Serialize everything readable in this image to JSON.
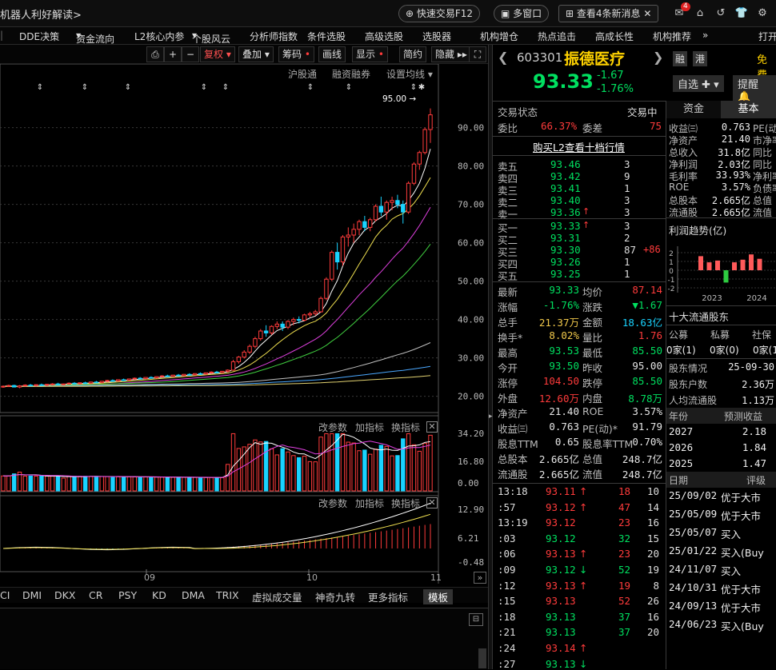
{
  "topbar": {
    "title": "机器人利好解读>",
    "quick_trade": "快速交易F12",
    "multi_window": "多窗口",
    "messages": "查看4条新消息",
    "mail_badge": "4"
  },
  "menu": [
    "DDE决策",
    "资金流向",
    "L2核心内参",
    "个股风云",
    "分析师指数",
    "条件选股",
    "高级选股",
    "选股器",
    "机构增仓",
    "热点追击",
    "高成长性",
    "机构推荐",
    "打开"
  ],
  "toolbar": {
    "fuquan": "复权",
    "diejia": "叠加",
    "chouma": "筹码",
    "huaxian": "画线",
    "xianshi": "显示",
    "jianyue": "简约",
    "yincang": "隐藏"
  },
  "chart_links": {
    "hgt": "沪股通",
    "rzrq": "融资融券",
    "settings": "设置均线"
  },
  "chart_data": {
    "type": "candlestick",
    "price_axis": [
      "90.00",
      "80.00",
      "70.00",
      "60.00",
      "50.00",
      "40.00",
      "30.00",
      "20.00"
    ],
    "max_label": "95.00",
    "ylim": [
      17,
      102
    ],
    "months": [
      "09",
      "10",
      "11"
    ],
    "candles": [
      [
        22.5,
        22.8,
        22.2,
        22.6
      ],
      [
        22.6,
        23.0,
        22.4,
        22.8
      ],
      [
        22.8,
        23.0,
        22.3,
        22.4
      ],
      [
        22.4,
        22.9,
        22.1,
        22.7
      ],
      [
        22.7,
        23.1,
        22.5,
        22.9
      ],
      [
        22.9,
        23.2,
        22.6,
        22.8
      ],
      [
        22.8,
        23.1,
        22.5,
        23.0
      ],
      [
        23.0,
        23.3,
        22.7,
        22.9
      ],
      [
        22.9,
        23.2,
        22.6,
        23.1
      ],
      [
        23.1,
        23.4,
        22.8,
        23.2
      ],
      [
        23.2,
        23.5,
        22.9,
        23.0
      ],
      [
        23.0,
        23.3,
        22.8,
        23.2
      ],
      [
        23.2,
        23.6,
        23.0,
        23.4
      ],
      [
        23.4,
        23.7,
        23.1,
        23.3
      ],
      [
        23.3,
        23.6,
        23.0,
        23.5
      ],
      [
        23.5,
        23.8,
        23.2,
        23.4
      ],
      [
        23.4,
        23.8,
        23.2,
        23.7
      ],
      [
        23.7,
        24.0,
        23.4,
        23.6
      ],
      [
        23.6,
        24.0,
        23.4,
        23.9
      ],
      [
        23.9,
        24.3,
        23.7,
        24.1
      ],
      [
        24.1,
        24.4,
        23.8,
        24.0
      ],
      [
        24.0,
        24.4,
        23.8,
        24.3
      ],
      [
        24.3,
        24.6,
        24.0,
        24.2
      ],
      [
        24.2,
        24.6,
        24.0,
        24.5
      ],
      [
        24.5,
        24.9,
        24.3,
        24.7
      ],
      [
        24.7,
        25.0,
        24.4,
        24.6
      ],
      [
        24.6,
        25.0,
        24.4,
        24.9
      ],
      [
        24.9,
        25.2,
        24.6,
        24.8
      ],
      [
        24.8,
        25.2,
        24.6,
        25.1
      ],
      [
        25.1,
        25.5,
        24.9,
        25.3
      ],
      [
        25.3,
        25.6,
        25.0,
        25.2
      ],
      [
        25.2,
        25.6,
        25.0,
        25.5
      ],
      [
        25.5,
        25.8,
        25.2,
        25.4
      ],
      [
        25.4,
        25.8,
        25.2,
        25.7
      ],
      [
        25.7,
        26.0,
        25.4,
        25.6
      ],
      [
        25.6,
        26.0,
        25.4,
        25.9
      ],
      [
        25.9,
        26.2,
        25.6,
        25.8
      ],
      [
        25.8,
        26.2,
        25.6,
        26.1
      ],
      [
        26.1,
        26.5,
        25.9,
        26.3
      ],
      [
        26.3,
        26.6,
        26.0,
        26.2
      ],
      [
        26.2,
        26.6,
        26.0,
        26.5
      ],
      [
        26.5,
        27.0,
        26.2,
        26.8
      ],
      [
        26.8,
        29.5,
        26.6,
        29.0
      ],
      [
        29.0,
        30.5,
        28.5,
        30.2
      ],
      [
        30.2,
        32.0,
        29.8,
        31.5
      ],
      [
        31.5,
        33.5,
        31.0,
        33.0
      ],
      [
        33.0,
        35.5,
        32.5,
        35.0
      ],
      [
        35.0,
        37.5,
        34.5,
        37.0
      ],
      [
        37.0,
        38.5,
        35.5,
        36.5
      ],
      [
        36.5,
        38.5,
        36.0,
        38.2
      ],
      [
        38.2,
        39.5,
        37.5,
        38.8
      ],
      [
        38.8,
        39.5,
        37.0,
        38.0
      ],
      [
        38.0,
        39.8,
        37.5,
        39.5
      ],
      [
        39.5,
        40.5,
        38.5,
        40.0
      ],
      [
        40.0,
        40.8,
        39.0,
        39.8
      ],
      [
        39.8,
        41.5,
        39.5,
        41.2
      ],
      [
        41.2,
        42.0,
        40.5,
        41.5
      ],
      [
        41.5,
        42.5,
        41.0,
        42.0
      ],
      [
        42.0,
        46.0,
        41.8,
        45.5
      ],
      [
        45.5,
        51.0,
        45.0,
        50.5
      ],
      [
        50.5,
        58.0,
        50.0,
        57.5
      ],
      [
        57.5,
        60.0,
        53.0,
        55.0
      ],
      [
        55.0,
        62.0,
        54.0,
        61.5
      ],
      [
        61.5,
        64.0,
        59.0,
        62.0
      ],
      [
        62.0,
        65.0,
        60.0,
        63.5
      ],
      [
        63.5,
        66.0,
        62.0,
        65.5
      ],
      [
        65.5,
        67.0,
        63.0,
        64.0
      ],
      [
        64.0,
        66.5,
        63.0,
        66.0
      ],
      [
        66.0,
        70.0,
        65.5,
        69.5
      ],
      [
        69.5,
        72.0,
        67.0,
        68.0
      ],
      [
        68.0,
        71.0,
        66.0,
        70.5
      ],
      [
        70.5,
        72.0,
        68.5,
        71.0
      ],
      [
        71.0,
        72.5,
        69.0,
        70.0
      ],
      [
        70.0,
        71.0,
        65.0,
        68.0
      ],
      [
        68.0,
        76.0,
        67.5,
        75.5
      ],
      [
        75.5,
        81.0,
        75.0,
        80.5
      ],
      [
        80.5,
        84.0,
        79.0,
        83.5
      ],
      [
        83.5,
        90.0,
        83.0,
        89.5
      ],
      [
        89.5,
        95.0,
        86.0,
        93.33
      ]
    ]
  },
  "indicator_labels": {
    "params": "改参数",
    "add": "加指标",
    "change": "换指标"
  },
  "vol_axis": [
    "34.20",
    "16.80",
    "0.00"
  ],
  "macd_axis": [
    "12.90",
    "6.21",
    "-0.48"
  ],
  "bottom_tabs": [
    "CI",
    "DMI",
    "DKX",
    "CR",
    "PSY",
    "KD",
    "DMA",
    "TRIX",
    "虚拟成交量",
    "神奇九转",
    "更多指标",
    "模板"
  ],
  "stock": {
    "code": "603301",
    "name": "振德医疗",
    "tags": [
      "融",
      "港"
    ],
    "free_label": "免费",
    "price": "93.33",
    "change": "-1.67",
    "change_pct": "-1.76%",
    "zixuan": "自选",
    "tixing": "提醒"
  },
  "trade_status": {
    "label": "交易状态",
    "value": "交易中"
  },
  "weibi": {
    "label": "委比",
    "value": "66.37%",
    "label2": "委差",
    "value2": "75"
  },
  "l2_link": "购买L2查看十档行情",
  "asks": [
    {
      "label": "卖五",
      "price": "93.46",
      "vol": "3"
    },
    {
      "label": "卖四",
      "price": "93.42",
      "vol": "9"
    },
    {
      "label": "卖三",
      "price": "93.41",
      "vol": "1"
    },
    {
      "label": "卖二",
      "price": "93.40",
      "vol": "3"
    },
    {
      "label": "卖一",
      "price": "93.36",
      "vol": "3"
    }
  ],
  "bids": [
    {
      "label": "买一",
      "price": "93.33",
      "vol": "3",
      "chg": ""
    },
    {
      "label": "买二",
      "price": "93.31",
      "vol": "2",
      "chg": ""
    },
    {
      "label": "买三",
      "price": "93.30",
      "vol": "87",
      "chg": "+86"
    },
    {
      "label": "买四",
      "price": "93.26",
      "vol": "1",
      "chg": ""
    },
    {
      "label": "买五",
      "price": "93.25",
      "vol": "1",
      "chg": ""
    }
  ],
  "stats": [
    {
      "l1": "最新",
      "v1": "93.33",
      "c1": "green",
      "l2": "均价",
      "v2": "87.14",
      "c2": "red"
    },
    {
      "l1": "涨幅",
      "v1": "-1.76%",
      "c1": "green",
      "l2": "涨跌",
      "v2": "▼1.67",
      "c2": "green"
    },
    {
      "l1": "总手",
      "v1": "21.37万",
      "c1": "yellow",
      "l2": "金额",
      "v2": "18.63亿",
      "c2": "cyan"
    },
    {
      "l1": "换手*",
      "v1": "8.02%",
      "c1": "yellow",
      "l2": "量比",
      "v2": "1.76",
      "c2": "red"
    },
    {
      "l1": "最高",
      "v1": "93.53",
      "c1": "green",
      "l2": "最低",
      "v2": "85.50",
      "c2": "green"
    },
    {
      "l1": "今开",
      "v1": "93.50",
      "c1": "green",
      "l2": "昨收",
      "v2": "95.00",
      "c2": "white"
    },
    {
      "l1": "涨停",
      "v1": "104.50",
      "c1": "red",
      "l2": "跌停",
      "v2": "85.50",
      "c2": "green"
    },
    {
      "l1": "外盘",
      "v1": "12.60万",
      "c1": "red",
      "l2": "内盘",
      "v2": "8.78万",
      "c2": "green"
    },
    {
      "l1": "净资产",
      "v1": "21.40",
      "c1": "white",
      "l2": "ROE",
      "v2": "3.57%",
      "c2": "white"
    },
    {
      "l1": "收益㈢",
      "v1": "0.763",
      "c1": "white",
      "l2": "PE(动)*",
      "v2": "91.79",
      "c2": "white"
    },
    {
      "l1": "股息TTM",
      "v1": "0.65",
      "c1": "white",
      "l2": "股息率TTM",
      "v2": "0.70%",
      "c2": "white"
    },
    {
      "l1": "总股本",
      "v1": "2.665亿",
      "c1": "white",
      "l2": "总值",
      "v2": "248.7亿",
      "c2": "white"
    },
    {
      "l1": "流通股",
      "v1": "2.665亿",
      "c1": "white",
      "l2": "流值",
      "v2": "248.7亿",
      "c2": "white"
    }
  ],
  "ticks": [
    {
      "t": "13:18",
      "p": "93.11",
      "a": "↑",
      "c": "red",
      "v": "18",
      "n": "10"
    },
    {
      "t": ":57",
      "p": "93.12",
      "a": "↑",
      "c": "red",
      "v": "47",
      "n": "14"
    },
    {
      "t": "13:19",
      "p": "93.12",
      "a": "",
      "c": "red",
      "v": "23",
      "n": "16"
    },
    {
      "t": ":03",
      "p": "93.12",
      "a": "",
      "c": "green",
      "v": "32",
      "n": "15"
    },
    {
      "t": ":06",
      "p": "93.13",
      "a": "↑",
      "c": "red",
      "v": "23",
      "n": "20"
    },
    {
      "t": ":09",
      "p": "93.12",
      "a": "↓",
      "c": "green",
      "v": "52",
      "n": "19"
    },
    {
      "t": ":12",
      "p": "93.13",
      "a": "↑",
      "c": "red",
      "v": "19",
      "n": "8"
    },
    {
      "t": ":15",
      "p": "93.13",
      "a": "",
      "c": "red",
      "v": "52",
      "n": "26"
    },
    {
      "t": ":18",
      "p": "93.13",
      "a": "",
      "c": "green",
      "v": "37",
      "n": "16"
    },
    {
      "t": ":21",
      "p": "93.13",
      "a": "",
      "c": "green",
      "v": "37",
      "n": "20"
    },
    {
      "t": ":24",
      "p": "93.14",
      "a": "↑",
      "c": "red",
      "v": "",
      "n": ""
    },
    {
      "t": ":27",
      "p": "93.13",
      "a": "↓",
      "c": "green",
      "v": "",
      "n": ""
    }
  ],
  "f10": {
    "tabs": [
      "资金",
      "基本"
    ],
    "rows": [
      {
        "l": "收益㈢",
        "v": "0.763",
        "x": "PE(动"
      },
      {
        "l": "净资产",
        "v": "21.40",
        "x": "市净率"
      },
      {
        "l": "总收入",
        "v": "31.8亿",
        "x": "同比"
      },
      {
        "l": "净利润",
        "v": "2.03亿",
        "x": "同比"
      },
      {
        "l": "毛利率",
        "v": "33.93%",
        "x": "净利率"
      },
      {
        "l": "ROE",
        "v": "3.57%",
        "x": "负债率"
      },
      {
        "l": "总股本",
        "v": "2.665亿",
        "x": "总值"
      },
      {
        "l": "流通股",
        "v": "2.665亿",
        "x": "流值"
      }
    ],
    "profit_title": "利润趋势(亿)",
    "profit_years": [
      "2023",
      "2024"
    ],
    "profit_axis": [
      "2",
      "1",
      "0",
      "-1",
      "-2"
    ],
    "profit_bars": [
      1.6,
      0.9,
      1.1,
      -1.4,
      0.9,
      1.2,
      1.8,
      1.3
    ],
    "holders_title": "十大流通股东",
    "holders_head": [
      "公募",
      "私募",
      "社保"
    ],
    "holders_vals": [
      "0家(1)",
      "0家(0)",
      "0家(1"
    ],
    "holders_info": [
      {
        "l": "股东情况",
        "v": "25-09-30"
      },
      {
        "l": "股东户数",
        "v": "2.36万"
      },
      {
        "l": "人均流通股",
        "v": "1.13万"
      }
    ],
    "eps_head": [
      "年份",
      "预测收益"
    ],
    "eps": [
      {
        "y": "2027",
        "v": "2.18"
      },
      {
        "y": "2026",
        "v": "1.84"
      },
      {
        "y": "2025",
        "v": "1.47"
      }
    ],
    "rating_head": [
      "日期",
      "评级"
    ],
    "ratings": [
      {
        "d": "25/09/02",
        "r": "优于大市"
      },
      {
        "d": "25/05/09",
        "r": "优于大市"
      },
      {
        "d": "25/05/07",
        "r": "买入"
      },
      {
        "d": "25/01/22",
        "r": "买入(Buy"
      },
      {
        "d": "24/11/07",
        "r": "买入"
      },
      {
        "d": "24/10/31",
        "r": "优于大市"
      },
      {
        "d": "24/09/13",
        "r": "优于大市"
      },
      {
        "d": "24/06/23",
        "r": "买入(Buy"
      }
    ]
  }
}
